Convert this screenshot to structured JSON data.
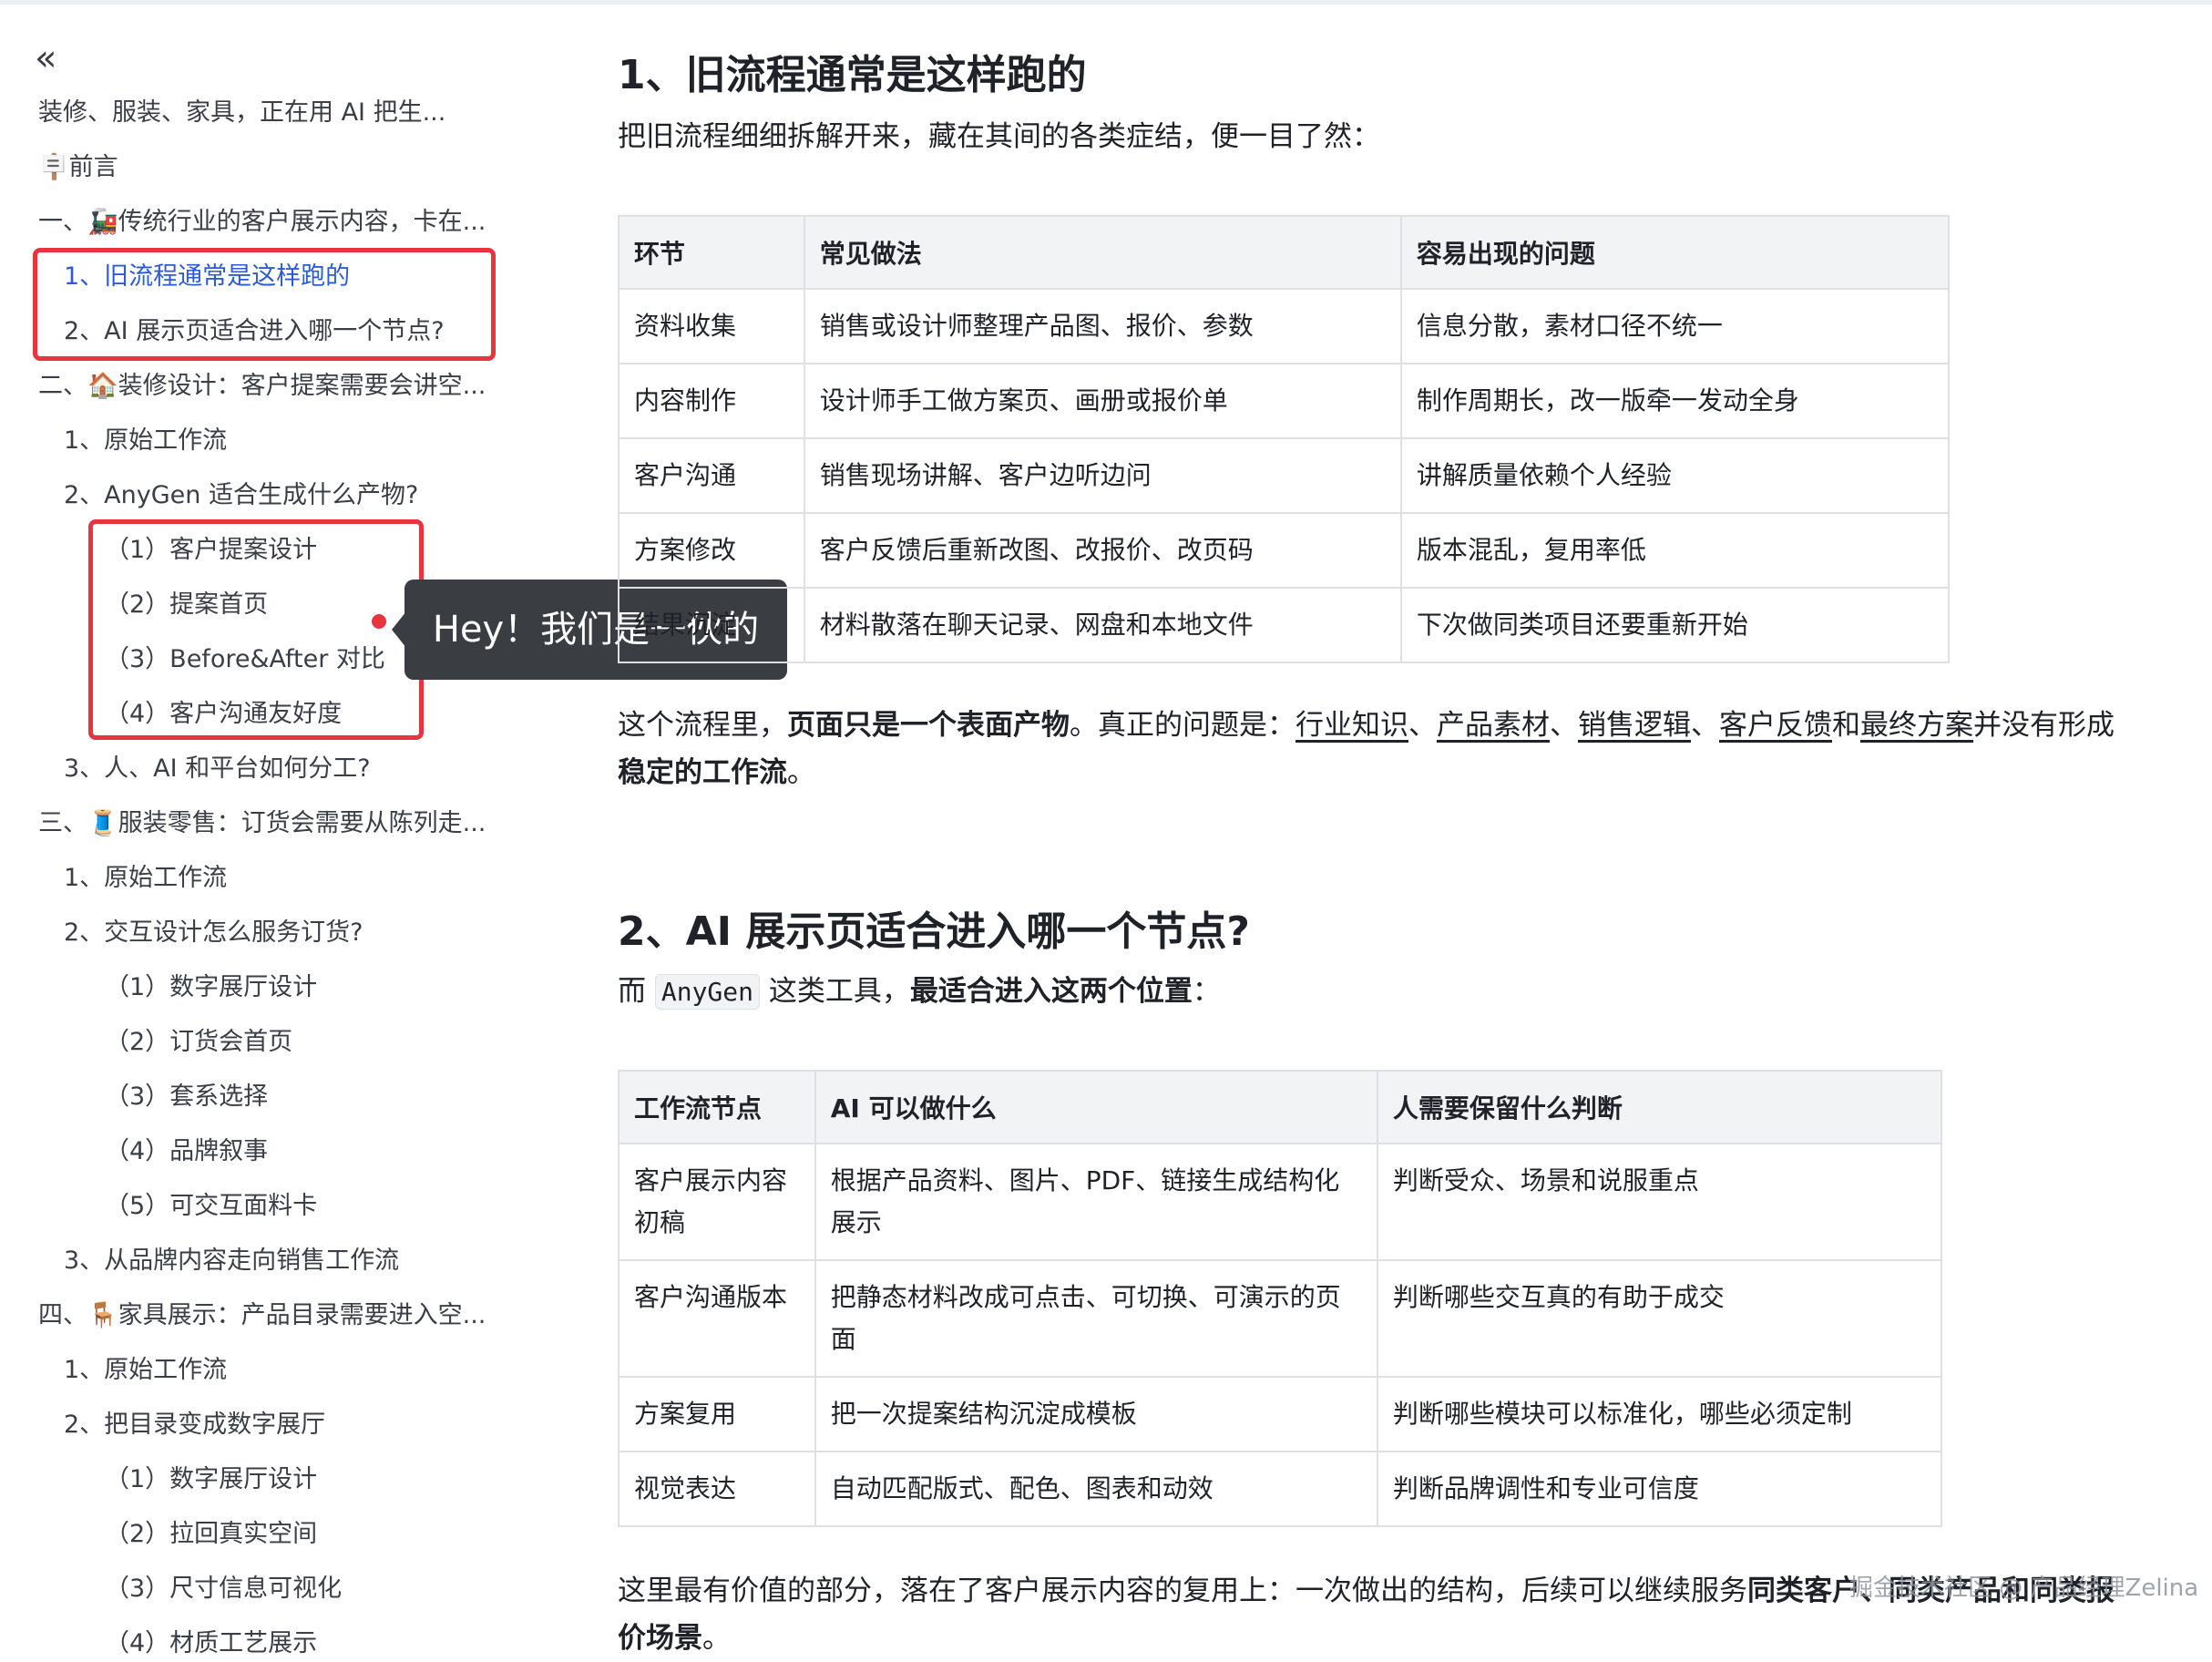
{
  "sidebar": {
    "collapse_glyph": "«",
    "toc": [
      {
        "level": 0,
        "text": "装修、服装、家具，正在用 AI 把生..."
      },
      {
        "level": 0,
        "text": "🪧前言"
      },
      {
        "level": 0,
        "text": "一、🚂传统行业的客户展示内容，卡在..."
      },
      {
        "level": 1,
        "text": "1、旧流程通常是这样跑的",
        "active": true
      },
      {
        "level": 1,
        "text": "2、AI 展示页适合进入哪一个节点?"
      },
      {
        "level": 0,
        "text": "二、🏠装修设计：客户提案需要会讲空..."
      },
      {
        "level": 1,
        "text": "1、原始工作流"
      },
      {
        "level": 1,
        "text": "2、AnyGen 适合生成什么产物?"
      },
      {
        "level": 2,
        "text": "（1）客户提案设计"
      },
      {
        "level": 2,
        "text": "（2）提案首页"
      },
      {
        "level": 2,
        "text": "（3）Before&After 对比"
      },
      {
        "level": 2,
        "text": "（4）客户沟通友好度"
      },
      {
        "level": 1,
        "text": "3、人、AI 和平台如何分工?"
      },
      {
        "level": 0,
        "text": "三、🧵服装零售：订货会需要从陈列走..."
      },
      {
        "level": 1,
        "text": "1、原始工作流"
      },
      {
        "level": 1,
        "text": "2、交互设计怎么服务订货?"
      },
      {
        "level": 2,
        "text": "（1）数字展厅设计"
      },
      {
        "level": 2,
        "text": "（2）订货会首页"
      },
      {
        "level": 2,
        "text": "（3）套系选择"
      },
      {
        "level": 2,
        "text": "（4）品牌叙事"
      },
      {
        "level": 2,
        "text": "（5）可交互面料卡"
      },
      {
        "level": 1,
        "text": "3、从品牌内容走向销售工作流"
      },
      {
        "level": 0,
        "text": "四、🪑家具展示：产品目录需要进入空..."
      },
      {
        "level": 1,
        "text": "1、原始工作流"
      },
      {
        "level": 1,
        "text": "2、把目录变成数字展厅"
      },
      {
        "level": 2,
        "text": "（1）数字展厅设计"
      },
      {
        "level": 2,
        "text": "（2）拉回真实空间"
      },
      {
        "level": 2,
        "text": "（3）尺寸信息可视化"
      },
      {
        "level": 2,
        "text": "（4）材质工艺展示"
      }
    ]
  },
  "tooltip": {
    "text": "Hey！我们是一伙的"
  },
  "main": {
    "section1": {
      "title": "1、旧流程通常是这样跑的",
      "intro": "把旧流程细细拆解开来，藏在其间的各类症结，便一目了然：",
      "table": {
        "headers": [
          "环节",
          "常见做法",
          "容易出现的问题"
        ],
        "rows": [
          [
            "资料收集",
            "销售或设计师整理产品图、报价、参数",
            "信息分散，素材口径不统一"
          ],
          [
            "内容制作",
            "设计师手工做方案页、画册或报价单",
            "制作周期长，改一版牵一发动全身"
          ],
          [
            "客户沟通",
            "销售现场讲解、客户边听边问",
            "讲解质量依赖个人经验"
          ],
          [
            "方案修改",
            "客户反馈后重新改图、改报价、改页码",
            "版本混乱，复用率低"
          ],
          [
            "结果沉淀",
            "材料散落在聊天记录、网盘和本地文件",
            "下次做同类项目还要重新开始"
          ]
        ]
      },
      "summary": {
        "p1": "这个流程里，",
        "b1": "页面只是一个表面产物",
        "p2": "。真正的问题是：",
        "u1": "行业知识",
        "s1": "、",
        "u2": "产品素材",
        "s2": "、",
        "u3": "销售逻辑",
        "s3": "、",
        "u4": "客户反馈",
        "s4": "和",
        "u5": "最终方案",
        "p3": "并没有形成",
        "b2": "稳定的工作流",
        "p4": "。"
      }
    },
    "section2": {
      "title": "2、AI 展示页适合进入哪一个节点?",
      "intro_pre": "而",
      "intro_code": "AnyGen",
      "intro_mid": "这类工具，",
      "intro_bold": "最适合进入这两个位置",
      "intro_post": "：",
      "table": {
        "headers": [
          "工作流节点",
          "AI 可以做什么",
          "人需要保留什么判断"
        ],
        "rows": [
          [
            "客户展示内容初稿",
            "根据产品资料、图片、PDF、链接生成结构化展示",
            "判断受众、场景和说服重点"
          ],
          [
            "客户沟通版本",
            "把静态材料改成可点击、可切换、可演示的页面",
            "判断哪些交互真的有助于成交"
          ],
          [
            "方案复用",
            "把一次提案结构沉淀成模板",
            "判断哪些模块可以标准化，哪些必须定制"
          ],
          [
            "视觉表达",
            "自动匹配版式、配色、图表和动效",
            "判断品牌调性和专业可信度"
          ]
        ]
      },
      "closing": {
        "p1": "这里最有价值的部分，落在了客户展示内容的复用上：一次做出的结构，后续可以继续服务",
        "b1": "同类客户、同类产品和同类报价场景",
        "p2": "。"
      }
    }
  },
  "watermark": "掘金技术社区 @ 产品经理Zelina"
}
